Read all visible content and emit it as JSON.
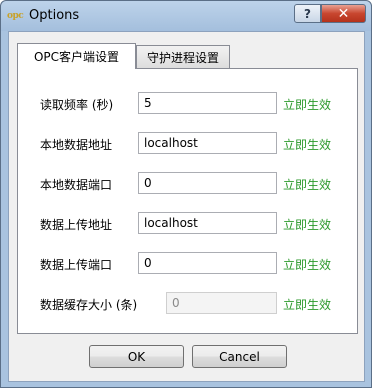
{
  "window": {
    "title": "Options",
    "icon_text": "opc",
    "help_label": "?",
    "close_label": "✕"
  },
  "tabs": [
    {
      "label": "OPC客户端设置",
      "active": true
    },
    {
      "label": "守护进程设置",
      "active": false
    }
  ],
  "settings": [
    {
      "label": "读取频率 (秒)",
      "value": "5",
      "enabled": true,
      "action": "立即生效"
    },
    {
      "label": "本地数据地址",
      "value": "localhost",
      "enabled": true,
      "action": "立即生效"
    },
    {
      "label": "本地数据端口",
      "value": "0",
      "enabled": true,
      "action": "立即生效"
    },
    {
      "label": "数据上传地址",
      "value": "localhost",
      "enabled": true,
      "action": "立即生效"
    },
    {
      "label": "数据上传端口",
      "value": "0",
      "enabled": true,
      "action": "立即生效"
    },
    {
      "label": "数据缓存大小 (条)",
      "value": "0",
      "enabled": false,
      "action": "立即生效"
    }
  ],
  "buttons": {
    "ok": "OK",
    "cancel": "Cancel"
  },
  "colors": {
    "action_link": "#2c9a2c",
    "frame": "#a9c3df",
    "close_button": "#c8462f"
  }
}
